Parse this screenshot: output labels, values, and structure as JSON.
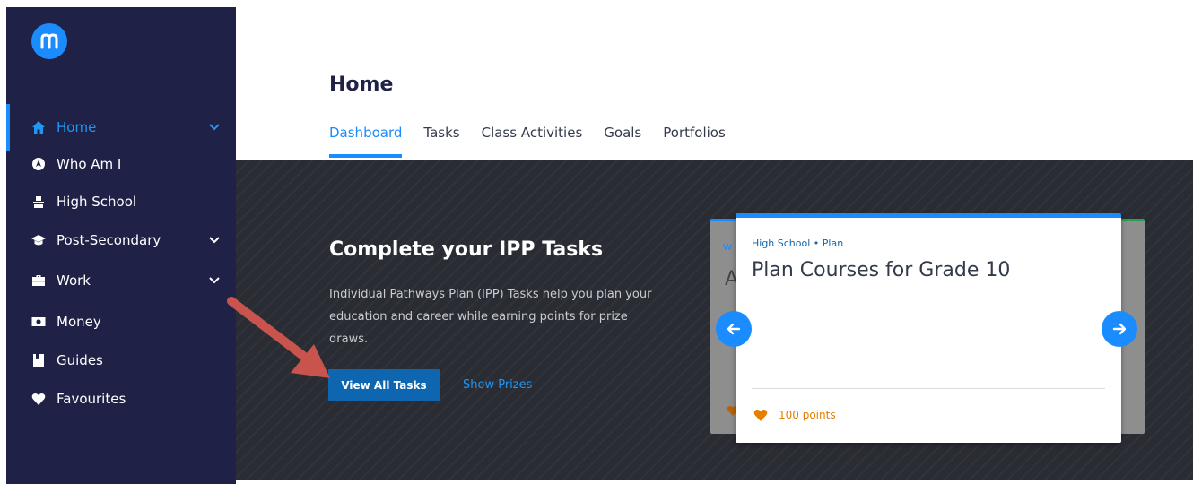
{
  "brand": {
    "logo_letter": "m",
    "accent": "#1a8cff",
    "sidebar_bg": "#1f2147"
  },
  "sidebar": {
    "items": [
      {
        "label": "Home",
        "icon": "home-icon",
        "active": true,
        "expandable": true
      },
      {
        "label": "Who Am I",
        "icon": "compass-icon",
        "active": false,
        "expandable": false
      },
      {
        "label": "High School",
        "icon": "school-icon",
        "active": false,
        "expandable": false
      },
      {
        "label": "Post-Secondary",
        "icon": "graduation-cap-icon",
        "active": false,
        "expandable": true
      },
      {
        "label": "Work",
        "icon": "briefcase-icon",
        "active": false,
        "expandable": true
      },
      {
        "label": "Money",
        "icon": "money-icon",
        "active": false,
        "expandable": false
      },
      {
        "label": "Guides",
        "icon": "book-icon",
        "active": false,
        "expandable": false
      },
      {
        "label": "Favourites",
        "icon": "heart-icon",
        "active": false,
        "expandable": false
      }
    ]
  },
  "header": {
    "title": "Home",
    "tabs": [
      "Dashboard",
      "Tasks",
      "Class Activities",
      "Goals",
      "Portfolios"
    ],
    "active_tab": "Dashboard"
  },
  "hero": {
    "title": "Complete your IPP Tasks",
    "description": "Individual Pathways Plan (IPP) Tasks help you plan your education and career while earning points for prize draws.",
    "primary_button": "View All Tasks",
    "secondary_link": "Show Prizes"
  },
  "carousel": {
    "prev_card": {
      "category_fragment": "W",
      "title_fragment": "A"
    },
    "card": {
      "category": "High School • Plan",
      "title": "Plan Courses for Grade 10",
      "points": "100 points"
    },
    "prev_icon": "arrow-left-icon",
    "next_icon": "arrow-right-icon"
  }
}
